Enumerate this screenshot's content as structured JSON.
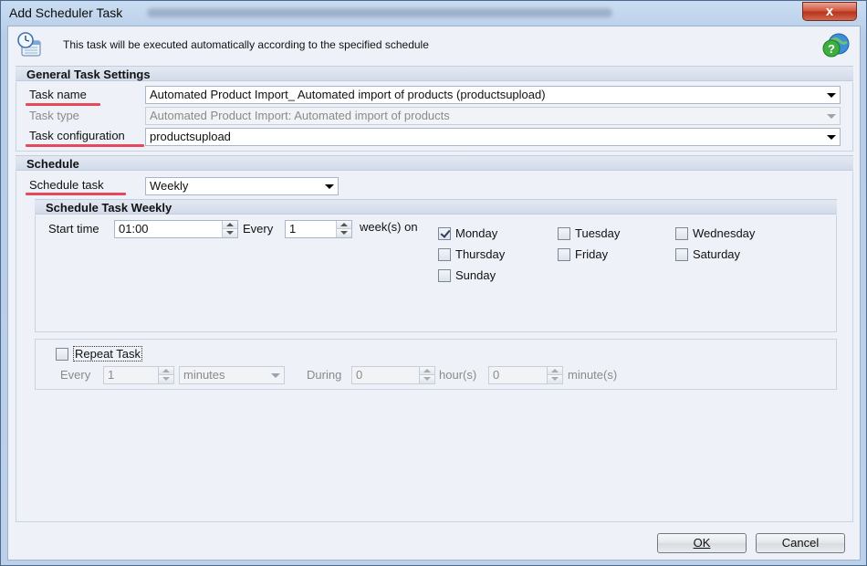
{
  "window": {
    "title": "Add Scheduler Task",
    "close_label": "x",
    "info_text": "This task will be executed automatically according to the specified schedule",
    "icons": {
      "info": "clock-calendar-icon",
      "help": "help-globe-icon",
      "close": "close-icon"
    }
  },
  "general": {
    "header": "General Task Settings",
    "task_name_label": "Task name",
    "task_name_value": "Automated Product Import_ Automated import of products (productsupload)",
    "task_type_label": "Task type",
    "task_type_value": "Automated Product Import: Automated import of products",
    "task_config_label": "Task configuration",
    "task_config_value": "productsupload"
  },
  "schedule": {
    "header": "Schedule",
    "schedule_task_label": "Schedule task",
    "schedule_task_value": "Weekly",
    "weekly": {
      "header": "Schedule Task Weekly",
      "start_time_label": "Start time",
      "start_time_value": "01:00",
      "every_label": "Every",
      "every_value": "1",
      "weeks_on_label": "week(s) on",
      "days": [
        {
          "label": "Monday",
          "checked": true
        },
        {
          "label": "Tuesday",
          "checked": false
        },
        {
          "label": "Wednesday",
          "checked": false
        },
        {
          "label": "Thursday",
          "checked": false
        },
        {
          "label": "Friday",
          "checked": false
        },
        {
          "label": "Saturday",
          "checked": false
        },
        {
          "label": "Sunday",
          "checked": false
        }
      ]
    },
    "repeat": {
      "label": "Repeat Task",
      "checked": false,
      "every_label": "Every",
      "every_value": "1",
      "unit_value": "minutes",
      "during_label": "During",
      "hours_value": "0",
      "hours_label": "hour(s)",
      "minutes_value": "0",
      "minutes_label": "minute(s)"
    }
  },
  "buttons": {
    "ok_label": "OK",
    "cancel_label": "Cancel"
  },
  "colors": {
    "highlight_underline": "#e64a5a"
  }
}
